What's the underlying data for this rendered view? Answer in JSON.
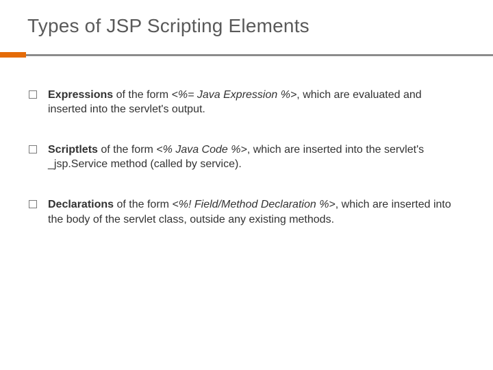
{
  "title": "Types of JSP Scripting Elements",
  "items": [
    {
      "lead": "Expressions",
      "mid1": " of the form ",
      "code": "<%= Java Expression %>",
      "tail": ", which are evaluated and inserted into the servlet's output."
    },
    {
      "lead": "Scriptlets",
      "mid1": " of the form ",
      "code": "<% Java Code %>",
      "tail": ", which are inserted into the servlet's _jsp.Service method (called by service)."
    },
    {
      "lead": "Declarations",
      "mid1": " of the form ",
      "code": "<%! Field/Method Declaration %>",
      "tail": ", which are inserted into the body of the servlet class, outside any existing methods."
    }
  ]
}
